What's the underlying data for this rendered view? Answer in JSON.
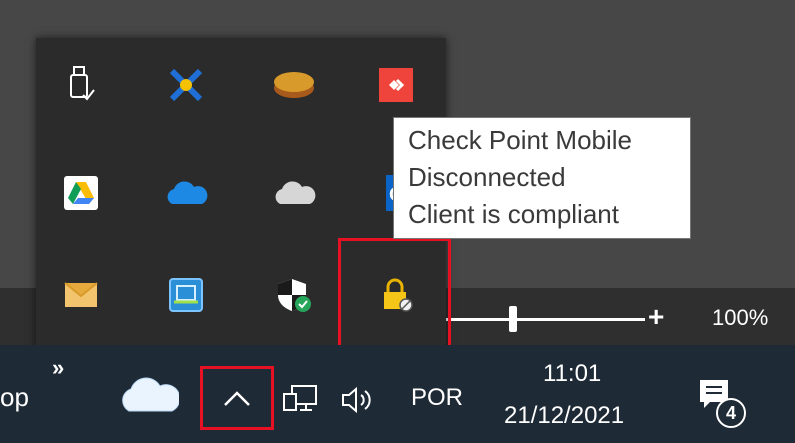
{
  "tooltip": {
    "line1": "Check Point Mobile",
    "line2": "Disconnected",
    "line3": "Client is compliant"
  },
  "zoom": {
    "plus_symbol": "+",
    "value": "100%"
  },
  "taskbar": {
    "left_label": "op",
    "overflow_symbol": "»",
    "language": "POR",
    "time": "11:01",
    "date": "21/12/2021",
    "notification_count": "4"
  },
  "tray_icons": [
    "usb-safely-remove-icon",
    "network-x-icon",
    "gold-disc-icon",
    "anydesk-icon",
    "google-drive-icon",
    "onedrive-blue-icon",
    "onedrive-grey-icon",
    "outlook-icon",
    "mail-icon",
    "vpn-app-icon",
    "windows-security-icon",
    "checkpoint-vpn-lock-icon"
  ],
  "colors": {
    "highlight": "#e81123",
    "taskbar": "#1e2a36",
    "popup": "#2b2b2b"
  }
}
